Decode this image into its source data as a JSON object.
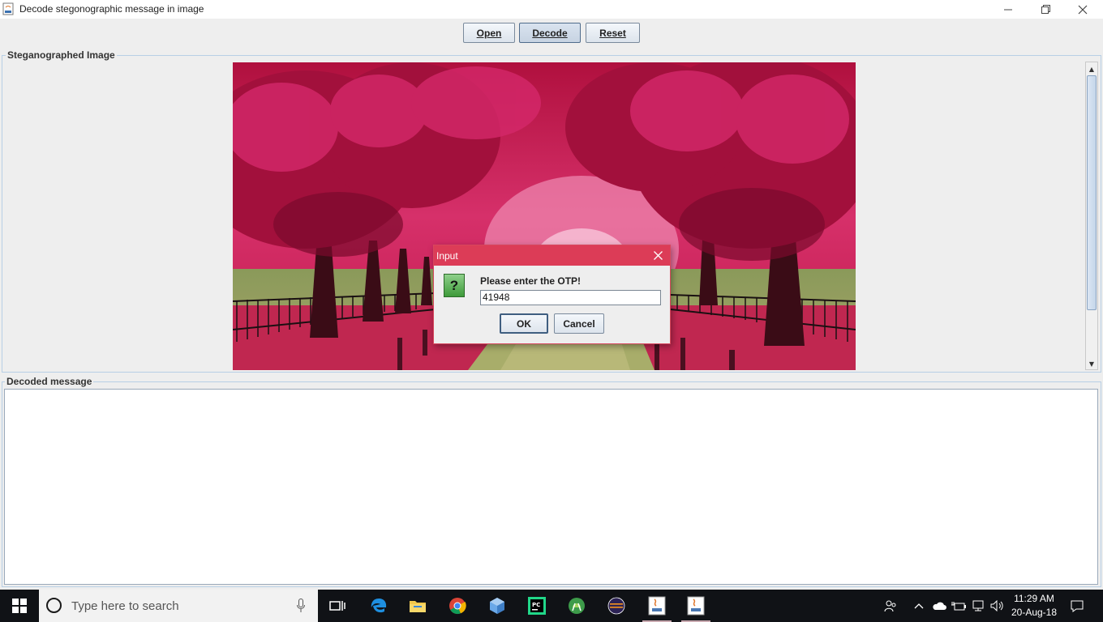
{
  "window": {
    "title": "Decode stegonographic message in image"
  },
  "toolbar": {
    "open_label": "Open",
    "decode_label": "Decode",
    "reset_label": "Reset"
  },
  "image_group": {
    "label": "Steganographed Image"
  },
  "message_group": {
    "label": "Decoded message",
    "value": ""
  },
  "dialog": {
    "title": "Input",
    "prompt": "Please enter the OTP!",
    "input_value": "41948",
    "ok_label": "OK",
    "cancel_label": "Cancel",
    "icon": "question-icon"
  },
  "taskbar": {
    "search_placeholder": "Type here to search",
    "apps": [
      "task-view",
      "edge",
      "file-explorer",
      "chrome",
      "box-app",
      "pycharm",
      "android-studio",
      "eclipse",
      "java",
      "java"
    ],
    "time": "11:29 AM",
    "date": "20-Aug-18"
  },
  "colors": {
    "dialog_title": "#dc3c57",
    "accent": "#b8cfe5"
  }
}
